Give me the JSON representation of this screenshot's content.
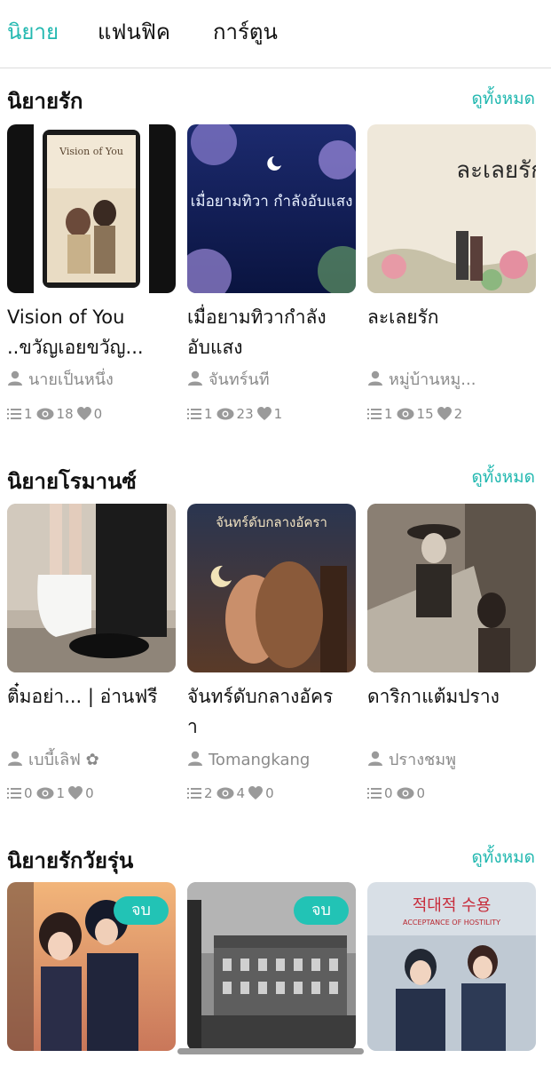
{
  "tabs": [
    {
      "label": "นิยาย",
      "active": true
    },
    {
      "label": "แฟนฟิค",
      "active": false
    },
    {
      "label": "การ์ตูน",
      "active": false
    }
  ],
  "see_all_label": "ดูทั้งหมด",
  "sections": [
    {
      "title": "นิยายรัก",
      "books": [
        {
          "title_lines": [
            "Vision of You",
            "..ขวัญเอยขวัญ..."
          ],
          "author": "นายเป็นหนึ่ง",
          "chapters": "1",
          "views": "18",
          "likes": "0",
          "cover_text": "Vision of You"
        },
        {
          "title_lines": [
            "เมื่อยามทิวากำลัง",
            "อับแสง"
          ],
          "author": "จันทร์นที",
          "chapters": "1",
          "views": "23",
          "likes": "1",
          "cover_text": "เมื่อยามทิวา กำลังอับแสง"
        },
        {
          "title_lines": [
            "ละเลยรัก"
          ],
          "author": "หมู่บ้านหมู...",
          "chapters": "1",
          "views": "15",
          "likes": "2",
          "cover_text": "ละเลยรัก"
        }
      ]
    },
    {
      "title": "นิยายโรมานซ์",
      "books": [
        {
          "title_lines": [
            "ติ๋มอย่า... | อ่านฟรี"
          ],
          "author": "เบบี้เลิฟ ✿",
          "chapters": "0",
          "views": "1",
          "likes": "0"
        },
        {
          "title_lines": [
            "จันทร์ดับกลางอัคร",
            "า"
          ],
          "author": "Tomangkang",
          "chapters": "2",
          "views": "4",
          "likes": "0",
          "cover_text": "จันทร์ดับกลางอัครา"
        },
        {
          "title_lines": [
            "ดาริกาแต้มปราง"
          ],
          "author": "ปรางชมพู",
          "chapters": "0",
          "views": "0",
          "likes": null
        }
      ]
    },
    {
      "title": "นิยายรักวัยรุ่น",
      "books": [
        {
          "badge": "จบ"
        },
        {
          "badge": "จบ"
        },
        {
          "cover_text": "적대적 수용",
          "cover_subtext": "ACCEPTANCE OF HOSTILITY"
        }
      ]
    }
  ],
  "colors": {
    "accent": "#22b8b0",
    "badge": "#22c3b5",
    "meta": "#8a8a8a"
  },
  "icons": {
    "author": "person-icon",
    "chapters": "list-icon",
    "views": "eye-icon",
    "likes": "heart-icon"
  }
}
